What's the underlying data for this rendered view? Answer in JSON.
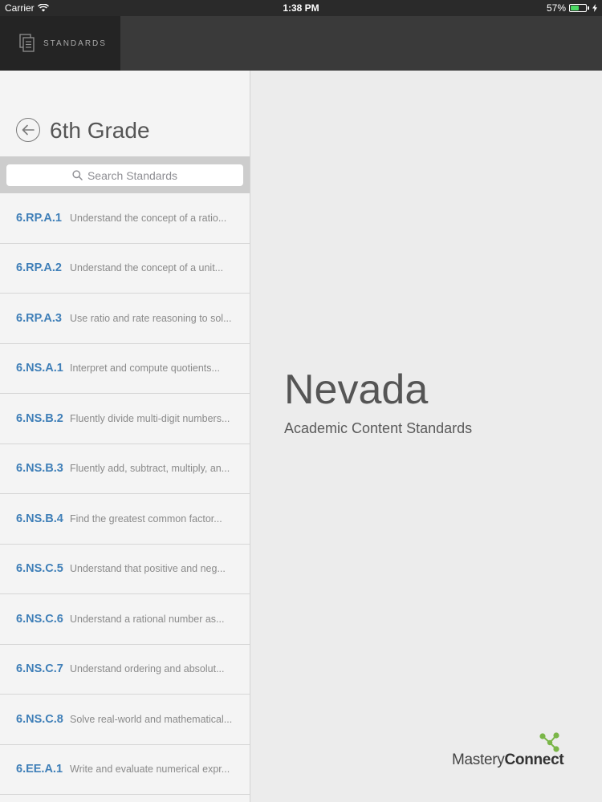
{
  "status": {
    "carrier": "Carrier",
    "time": "1:38 PM",
    "battery": "57%",
    "battery_level": 0.57
  },
  "topbar": {
    "tab_label": "STANDARDS",
    "tab_icon": "documents-icon"
  },
  "sidebar": {
    "title": "6th Grade",
    "back_icon": "back-arrow-icon",
    "search_placeholder": "Search Standards",
    "items": [
      {
        "code": "6.RP.A.1",
        "desc": "Understand the concept of a ratio..."
      },
      {
        "code": "6.RP.A.2",
        "desc": "Understand the concept of a unit..."
      },
      {
        "code": "6.RP.A.3",
        "desc": "Use ratio and rate reasoning to sol..."
      },
      {
        "code": "6.NS.A.1",
        "desc": "Interpret and compute quotients..."
      },
      {
        "code": "6.NS.B.2",
        "desc": "Fluently divide multi-digit numbers..."
      },
      {
        "code": "6.NS.B.3",
        "desc": "Fluently add, subtract, multiply, an..."
      },
      {
        "code": "6.NS.B.4",
        "desc": "Find the greatest common factor..."
      },
      {
        "code": "6.NS.C.5",
        "desc": "Understand that positive and neg..."
      },
      {
        "code": "6.NS.C.6",
        "desc": "Understand a rational number as..."
      },
      {
        "code": "6.NS.C.7",
        "desc": "Understand ordering and absolut..."
      },
      {
        "code": "6.NS.C.8",
        "desc": "Solve real-world and mathematical..."
      },
      {
        "code": "6.EE.A.1",
        "desc": "Write and evaluate numerical expr..."
      }
    ]
  },
  "main": {
    "state": "Nevada",
    "subtitle": "Academic Content Standards",
    "brand_light": "Mastery",
    "brand_bold": "Connect"
  },
  "colors": {
    "code_blue": "#3f7fb8",
    "brand_green": "#7ab648"
  }
}
